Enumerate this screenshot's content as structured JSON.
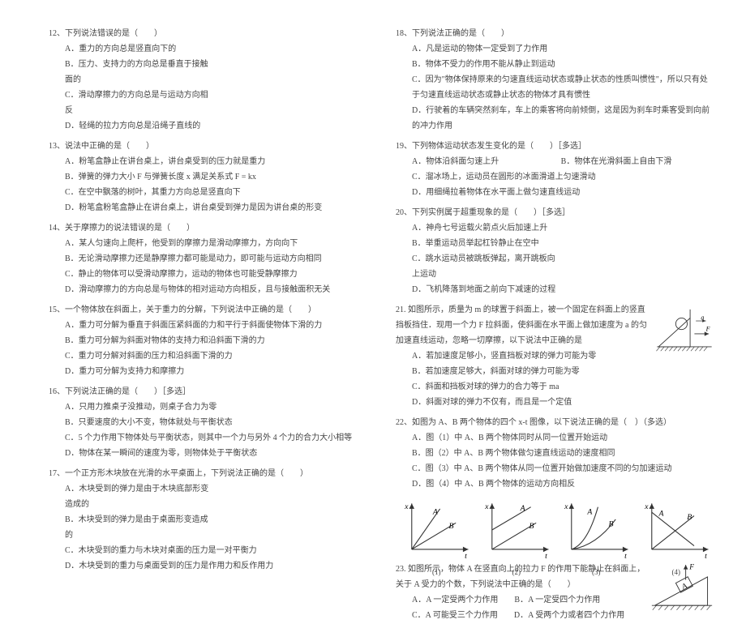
{
  "left": {
    "q12": {
      "stem": "12、下列说法错误的是（　　）",
      "a": "A．重力的方向总是竖直向下的",
      "b": "B．压力、支持力的方向总是垂直于接触面的",
      "c": "C．滑动摩擦力的方向总是与运动方向相反",
      "d": "D．轻绳的拉力方向总是沿绳子直线的"
    },
    "q13": {
      "stem": "13、说法中正确的是（　　）",
      "a": "A．粉笔盒静止在讲台桌上，讲台桌受到的压力就是重力",
      "b": "B．弹簧的弹力大小 F 与弹簧长度 x 满足关系式 F = kx",
      "c": "C．在空中飘落的树叶，其重力方向总是竖直向下",
      "d": "D．粉笔盒粉笔盒静止在讲台桌上，讲台桌受到弹力是因为讲台桌的形变"
    },
    "q14": {
      "stem": "14、关于摩擦力的说法错误的是（　　）",
      "a": "A．某人匀速向上爬杆，他受到的摩擦力是滑动摩擦力，方向向下",
      "b": "B．无论滑动摩擦力还是静摩擦力都可能是动力，即可能与运动方向相同",
      "c": "C．静止的物体可以受滑动摩擦力，运动的物体也可能受静摩擦力",
      "d": "D．滑动摩擦力的方向总是与物体的相对运动方向相反，且与接触面积无关"
    },
    "q15": {
      "stem": "15、一个物体放在斜面上，关于重力的分解，下列说法中正确的是（　　）",
      "a": "A．重力可分解为垂直于斜面压紧斜面的力和平行于斜面使物体下滑的力",
      "b": "B．重力可分解为斜面对物体的支持力和沿斜面下滑的力",
      "c": "C．重力可分解对斜面的压力和沿斜面下滑的力",
      "d": "D．重力可分解为支持力和摩擦力"
    },
    "q16": {
      "stem": "16、下列说法正确的是（　　）［多选］",
      "a": "A．只用力推桌子没推动，则桌子合力为零",
      "b": "B．只要速度的大小不变，物体就处与平衡状态",
      "c": "C．5 个力作用下物体处与平衡状态，则其中一个力与另外 4 个力的合力大小相等",
      "d": "D．物体在某一瞬间的速度为零，则物体处于平衡状态"
    },
    "q17": {
      "stem": "17、一个正方形木块放在光滑的水平桌面上，下列说法正确的是（　　）",
      "a": "A．木块受到的弹力是由于木块底部形变造成的",
      "b": "B．木块受到的弹力是由于桌面形变造成的",
      "c": "C．木块受到的重力与木块对桌面的压力是一对平衡力",
      "d": "D．木块受到的重力与桌面受到的压力是作用力和反作用力"
    }
  },
  "right": {
    "q18": {
      "stem": "18、下列说法正确的是（　　）",
      "a": "A．凡是运动的物体一定受到了力作用",
      "b": "B．物体不受力的作用不能从静止到运动",
      "c": "C．因为\"物体保持原来的匀速直线运动状态或静止状态的性质叫惯性\"，所以只有处于匀速直线运动状态或静止状态的物体才具有惯性",
      "d": "D．行驶着的车辆突然刹车，车上的乘客将向前倾倒，这是因为刹车时乘客受到向前的冲力作用"
    },
    "q19": {
      "stem": "19、下列物体运动状态发生变化的是（　　）［多选］",
      "a": "A．物体沿斜面匀速上升",
      "b": "B．物体在光滑斜面上自由下滑",
      "c": "C．溜冰场上，运动员在圆形的冰面滑道上匀速滑动",
      "d": "D．用细绳拉着物体在水平面上做匀速直线运动"
    },
    "q20": {
      "stem": "20、下列实例属于超重现象的是（　　）［多选］",
      "a": "A．神舟七号运载火箭点火后加速上升",
      "b": "B．举重运动员举起杠铃静止在空中",
      "c": "C．跳水运动员被跳板弹起，离开跳板向上运动",
      "d": "D．飞机降落到地面之前向下减速的过程"
    },
    "q21": {
      "stem": "21. 如图所示，质量为 m 的球置于斜面上，被一个固定在斜面上的竖直挡板挡住．现用一个力 F 拉斜面，使斜面在水平面上做加速度为 a 的匀加速直线运动，忽略一切摩擦，以下说法中正确的是",
      "a": "A．若加速度足够小，竖直挡板对球的弹力可能为零",
      "b": "B．若加速度足够大，斜面对球的弹力可能为零",
      "c": "C．斜面和挡板对球的弹力的合力等于 ma",
      "d": "D．斜面对球的弹力不仅有，而且是一个定值"
    },
    "q22": {
      "stem": "22、如图为 A、B 两个物体的四个 x-t 图像，以下说法正确的是（　）（多选）",
      "a": "A．图（1）中 A、B 两个物体同时从同一位置开始运动",
      "b": "B．图（2）中 A、B 两个物体做匀速直线运动的速度相同",
      "c": "C．图（3）中 A、B 两个物体从同一位置开始做加速度不同的匀加速运动",
      "d": "D．图（4）中 A、B 两个物体的运动方向相反"
    },
    "charts": {
      "labels": [
        "(1)",
        "(2)",
        "(3)",
        "(4)"
      ],
      "axis_x": "t",
      "axis_y": "x",
      "seriesA": "A",
      "seriesB": "B"
    },
    "q23": {
      "stem": "23. 如图所示，物体 A 在竖直向上的拉力 F 的作用下能静止在斜面上，关于 A 受力的个数，下列说法中正确的是（　　）",
      "a": "A．A 一定受两个力作用",
      "b": "B．A 一定受四个力作用",
      "c": "C．A 可能受三个力作用",
      "d": "D．A 受两个力或者四个力作用"
    }
  },
  "chart_data": [
    {
      "type": "line",
      "id": "(1)",
      "xlabel": "t",
      "ylabel": "x",
      "series": [
        {
          "name": "A",
          "desc": "straight line from origin, steeper slope"
        },
        {
          "name": "B",
          "desc": "straight line from origin, shallower slope"
        }
      ]
    },
    {
      "type": "line",
      "id": "(2)",
      "xlabel": "t",
      "ylabel": "x",
      "series": [
        {
          "name": "A",
          "desc": "straight line, positive intercept, positive slope"
        },
        {
          "name": "B",
          "desc": "parallel straight line, zero intercept, same slope"
        }
      ]
    },
    {
      "type": "line",
      "id": "(3)",
      "xlabel": "t",
      "ylabel": "x",
      "series": [
        {
          "name": "A",
          "desc": "curve from origin, concave up, steeper"
        },
        {
          "name": "B",
          "desc": "curve from origin, concave up, shallower"
        }
      ]
    },
    {
      "type": "line",
      "id": "(4)",
      "xlabel": "t",
      "ylabel": "x",
      "series": [
        {
          "name": "A",
          "desc": "straight line, positive intercept, negative slope"
        },
        {
          "name": "B",
          "desc": "straight line from origin, positive slope, crosses A"
        }
      ]
    }
  ]
}
